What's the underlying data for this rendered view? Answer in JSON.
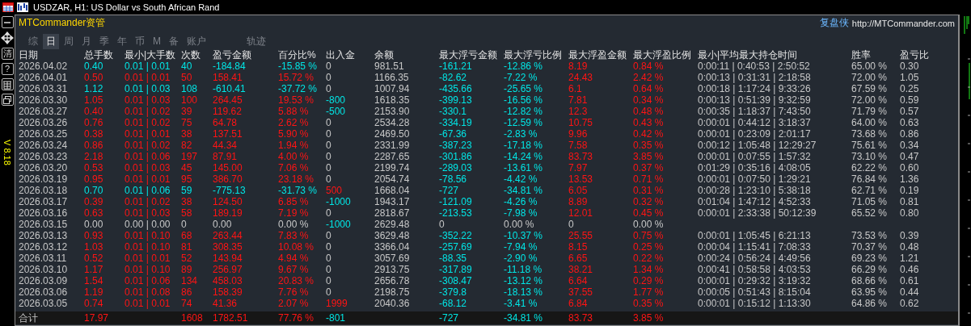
{
  "window": {
    "title": "USDZAR, H1:  US Dollar vs South African Rand"
  },
  "toolbar": {
    "buttons": [
      {
        "kind": "minus"
      },
      {
        "kind": "move"
      },
      {
        "kind": "text",
        "label": "清"
      },
      {
        "kind": "text",
        "label": "?"
      },
      {
        "kind": "grid"
      },
      {
        "kind": "restore"
      }
    ],
    "version": "V 8.18"
  },
  "header": {
    "brand": "MTCommander资管",
    "brand_right": "复盘侠",
    "url": "http://MTCommander.com"
  },
  "tabs": [
    {
      "label": "综",
      "selected": false
    },
    {
      "label": "日",
      "selected": true
    },
    {
      "label": "周",
      "selected": false
    },
    {
      "label": "月",
      "selected": false
    },
    {
      "label": "季",
      "selected": false
    },
    {
      "label": "年",
      "selected": false
    },
    {
      "label": "币",
      "selected": false
    },
    {
      "label": "M",
      "selected": false
    },
    {
      "label": "备",
      "selected": false
    },
    {
      "label": "账户",
      "selected": false
    },
    {
      "label": "轨迹",
      "selected": false
    }
  ],
  "table": {
    "columns": [
      "日期",
      "总手数",
      "最小|大手数",
      "次数",
      "盈亏金额",
      "百分比%",
      "出入金",
      "余额",
      "最大浮亏金额",
      "最大浮亏比例",
      "最大浮盈金额",
      "最大浮盈比例",
      "最小|平均最大持仓时间",
      "胜率",
      "盈亏比"
    ],
    "rows": [
      {
        "color": "#00e6e6",
        "float_active": true,
        "cells": [
          "2026.04.02",
          "0.40",
          "0.01 | 0.01",
          "40",
          "-184.84",
          "-15.85 %",
          {
            "text": "0",
            "color": "#c8c8c8"
          },
          "981.51",
          "-161.21",
          "-12.86 %",
          "8.19",
          "0.84 %",
          "0:00:11 | 0:40:53 | 2:50:52",
          "65.00 %",
          "0.30"
        ]
      },
      {
        "color": "#ff1414",
        "float_active": true,
        "cells": [
          "2026.04.01",
          "0.50",
          "0.01 | 0.01",
          "50",
          "158.41",
          "15.72 %",
          {
            "text": "0",
            "color": "#c8c8c8"
          },
          "1166.35",
          "-82.62",
          "-7.22 %",
          "24.43",
          "2.42 %",
          "0:00:13 | 0:31:31 | 2:18:58",
          "72.00 %",
          "1.05"
        ]
      },
      {
        "color": "#00e6e6",
        "float_active": true,
        "cells": [
          "2026.03.31",
          "1.12",
          "0.01 | 0.03",
          "108",
          "-610.41",
          "-37.72 %",
          {
            "text": "0",
            "color": "#c8c8c8"
          },
          "1007.94",
          "-435.66",
          "-25.65 %",
          "6.1",
          "0.64 %",
          "0:00:18 | 1:17:24 | 9:33:26",
          "67.59 %",
          "0.25"
        ]
      },
      {
        "color": "#ff1414",
        "float_active": true,
        "cells": [
          "2026.03.30",
          "1.05",
          "0.01 | 0.03",
          "100",
          "264.45",
          "19.53 %",
          {
            "text": "-800",
            "color": "#00e6e6"
          },
          "1618.35",
          "-399.13",
          "-16.56 %",
          "7.81",
          "0.34 %",
          "0:00:13 | 0:51:39 | 9:32:59",
          "72.00 %",
          "0.59"
        ]
      },
      {
        "color": "#ff1414",
        "float_active": true,
        "cells": [
          "2026.03.27",
          "0.40",
          "0.01 | 0.02",
          "39",
          "119.62",
          "5.88 %",
          {
            "text": "-500",
            "color": "#00e6e6"
          },
          "2153.90",
          "-330.1",
          "-12.82 %",
          "12.3",
          "0.48 %",
          "0:00:35 | 1:18:37 | 7:43:50",
          "71.79 %",
          "0.57"
        ]
      },
      {
        "color": "#ff1414",
        "float_active": true,
        "cells": [
          "2026.03.26",
          "0.76",
          "0.01 | 0.02",
          "75",
          "64.78",
          "2.62 %",
          {
            "text": "0",
            "color": "#c8c8c8"
          },
          "2534.28",
          "-334.19",
          "-12.59 %",
          "10.75",
          "0.43 %",
          "0:00:01 | 0:44:12 | 3:18:37",
          "64.00 %",
          "0.63"
        ]
      },
      {
        "color": "#ff1414",
        "float_active": true,
        "cells": [
          "2026.03.25",
          "0.38",
          "0.01 | 0.01",
          "38",
          "137.51",
          "5.90 %",
          {
            "text": "0",
            "color": "#c8c8c8"
          },
          "2469.50",
          "-67.36",
          "-2.83 %",
          "9.96",
          "0.42 %",
          "0:00:01 | 0:23:09 | 2:01:17",
          "73.68 %",
          "0.86"
        ]
      },
      {
        "color": "#ff1414",
        "float_active": true,
        "cells": [
          "2026.03.24",
          "0.86",
          "0.01 | 0.02",
          "82",
          "44.34",
          "1.94 %",
          {
            "text": "0",
            "color": "#c8c8c8"
          },
          "2331.99",
          "-387.23",
          "-17.18 %",
          "7.58",
          "0.35 %",
          "0:00:12 | 1:05:48 | 12:29:27",
          "75.61 %",
          "0.34"
        ]
      },
      {
        "color": "#ff1414",
        "float_active": true,
        "cells": [
          "2026.03.23",
          "2.18",
          "0.01 | 0.06",
          "197",
          "87.91",
          "4.00 %",
          {
            "text": "0",
            "color": "#c8c8c8"
          },
          "2287.65",
          "-301.86",
          "-14.24 %",
          "83.73",
          "3.85 %",
          "0:00:01 | 0:07:55 | 1:57:32",
          "73.10 %",
          "0.47"
        ]
      },
      {
        "color": "#ff1414",
        "float_active": true,
        "cells": [
          "2026.03.20",
          "0.53",
          "0.01 | 0.03",
          "45",
          "145.00",
          "7.06 %",
          {
            "text": "0",
            "color": "#c8c8c8"
          },
          "2199.74",
          "-289.03",
          "-13.61 %",
          "7.97",
          "0.37 %",
          "0:01:29 | 0:35:16 | 4:08:05",
          "62.22 %",
          "0.60"
        ]
      },
      {
        "color": "#ff1414",
        "float_active": true,
        "cells": [
          "2026.03.19",
          "0.95",
          "0.01 | 0.01",
          "95",
          "386.70",
          "23.18 %",
          {
            "text": "0",
            "color": "#c8c8c8"
          },
          "2054.74",
          "-78.56",
          "-4.42 %",
          "13.53",
          "0.71 %",
          "0:00:01 | 0:07:50 | 1:29:21",
          "76.84 %",
          "1.36"
        ]
      },
      {
        "color": "#00e6e6",
        "float_active": true,
        "cells": [
          "2026.03.18",
          "0.70",
          "0.01 | 0.06",
          "59",
          "-775.13",
          "-31.73 %",
          {
            "text": "500",
            "color": "#ff1414"
          },
          "1668.04",
          "-727",
          "-34.81 %",
          "6.05",
          "0.31 %",
          "0:00:28 | 1:23:10 | 5:38:18",
          "62.71 %",
          "0.19"
        ]
      },
      {
        "color": "#ff1414",
        "float_active": true,
        "cells": [
          "2026.03.17",
          "0.39",
          "0.01 | 0.02",
          "38",
          "124.50",
          "6.85 %",
          {
            "text": "-1000",
            "color": "#00e6e6"
          },
          "1943.17",
          "-121.09",
          "-4.26 %",
          "8.89",
          "0.32 %",
          "0:01:04 | 1:47:12 | 4:52:33",
          "71.05 %",
          "0.81"
        ]
      },
      {
        "color": "#ff1414",
        "float_active": true,
        "cells": [
          "2026.03.16",
          "0.63",
          "0.01 | 0.03",
          "58",
          "189.19",
          "7.19 %",
          {
            "text": "0",
            "color": "#c8c8c8"
          },
          "2818.67",
          "-213.53",
          "-7.98 %",
          "12.01",
          "0.45 %",
          "0:00:01 | 2:33:38 | 50:12:39",
          "65.52 %",
          "0.80"
        ]
      },
      {
        "color": "#c8c8c8",
        "float_active": false,
        "cells": [
          "2026.03.15",
          "0.00",
          "0.00 | 0.00",
          "0",
          "0.00",
          "0.00 %",
          {
            "text": "-1000",
            "color": "#00e6e6"
          },
          "2629.48",
          "0",
          "0.00 %",
          "0",
          "0.00 %"
        ]
      },
      {
        "color": "#ff1414",
        "float_active": true,
        "cells": [
          "2026.03.13",
          "0.93",
          "0.01 | 0.10",
          "68",
          "263.44",
          "7.83 %",
          {
            "text": "0",
            "color": "#c8c8c8"
          },
          "3629.48",
          "-352.22",
          "-10.37 %",
          "25.55",
          "0.75 %",
          "0:00:01 | 1:05:45 | 6:21:13",
          "73.53 %",
          "0.39"
        ]
      },
      {
        "color": "#ff1414",
        "float_active": true,
        "cells": [
          "2026.03.12",
          "1.03",
          "0.01 | 0.10",
          "81",
          "308.35",
          "10.08 %",
          {
            "text": "0",
            "color": "#c8c8c8"
          },
          "3366.04",
          "-257.69",
          "-7.94 %",
          "8.15",
          "0.25 %",
          "0:00:04 | 1:15:41 | 7:08:33",
          "70.37 %",
          "0.48"
        ]
      },
      {
        "color": "#ff1414",
        "float_active": true,
        "cells": [
          "2026.03.11",
          "0.52",
          "0.01 | 0.01",
          "52",
          "143.94",
          "4.94 %",
          {
            "text": "0",
            "color": "#c8c8c8"
          },
          "3057.69",
          "-88.35",
          "-2.90 %",
          "6.65",
          "0.22 %",
          "0:00:24 | 0:56:24 | 4:49:56",
          "69.23 %",
          "1.21"
        ]
      },
      {
        "color": "#ff1414",
        "float_active": true,
        "cells": [
          "2026.03.10",
          "1.17",
          "0.01 | 0.10",
          "89",
          "256.97",
          "9.67 %",
          {
            "text": "0",
            "color": "#c8c8c8"
          },
          "2913.75",
          "-317.89",
          "-11.18 %",
          "38.21",
          "1.34 %",
          "0:00:41 | 0:58:58 | 4:03:53",
          "66.29 %",
          "0.46"
        ]
      },
      {
        "color": "#ff1414",
        "float_active": true,
        "cells": [
          "2026.03.09",
          "1.54",
          "0.01 | 0.06",
          "134",
          "458.03",
          "20.83 %",
          {
            "text": "0",
            "color": "#c8c8c8"
          },
          "2656.78",
          "-308.47",
          "-13.12 %",
          "6.64",
          "0.29 %",
          "0:00:01 | 0:29:32 | 3:19:32",
          "68.66 %",
          "0.61"
        ]
      },
      {
        "color": "#ff1414",
        "float_active": true,
        "cells": [
          "2026.03.06",
          "1.19",
          "0.01 | 0.08",
          "86",
          "158.39",
          "7.76 %",
          {
            "text": "0",
            "color": "#c8c8c8"
          },
          "2198.75",
          "-379.8",
          "-18.13 %",
          "37.55",
          "1.77 %",
          "0:00:05 | 0:51:43 | 8:15:04",
          "63.95 %",
          "0.44"
        ]
      },
      {
        "color": "#ff1414",
        "float_active": true,
        "cells": [
          "2026.03.05",
          "0.74",
          "0.01 | 0.01",
          "74",
          "41.36",
          "2.07 %",
          {
            "text": "1999",
            "color": "#ff1414"
          },
          "2040.36",
          "-68.12",
          "-3.41 %",
          "6.84",
          "0.35 %",
          "0:00:01 | 0:15:12 | 1:13:30",
          "64.86 %",
          "0.62"
        ]
      }
    ],
    "totals": {
      "color": "#ff1414",
      "deposit": {
        "text": "-801",
        "color": "#00e6e6"
      },
      "label": "合计",
      "lots": "17.97",
      "trades": "1608",
      "pnl": "1782.51",
      "pct": "77.76 %",
      "max_float_loss": "-727",
      "max_float_loss_pct": "-34.81 %",
      "max_float_profit": "83.73",
      "max_float_profit_pct": "3.85 %"
    }
  }
}
